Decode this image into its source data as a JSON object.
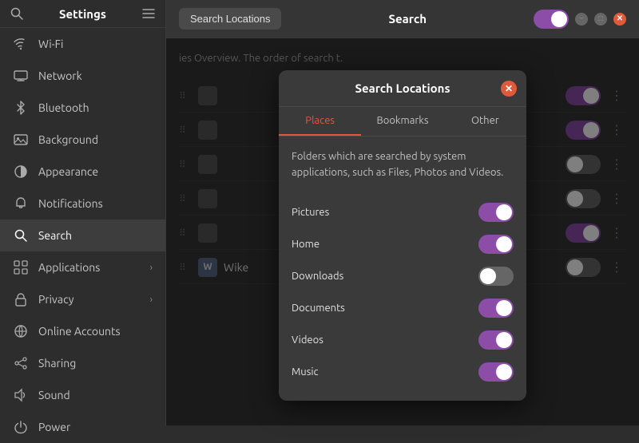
{
  "sidebar": {
    "title": "Settings",
    "items": [
      {
        "id": "wifi",
        "label": "Wi-Fi",
        "icon": "wifi"
      },
      {
        "id": "network",
        "label": "Network",
        "icon": "network"
      },
      {
        "id": "bluetooth",
        "label": "Bluetooth",
        "icon": "bluetooth"
      },
      {
        "id": "background",
        "label": "Background",
        "icon": "background"
      },
      {
        "id": "appearance",
        "label": "Appearance",
        "icon": "appearance"
      },
      {
        "id": "notifications",
        "label": "Notifications",
        "icon": "notifications"
      },
      {
        "id": "search",
        "label": "Search",
        "icon": "search",
        "active": true
      },
      {
        "id": "applications",
        "label": "Applications",
        "icon": "apps",
        "hasArrow": true
      },
      {
        "id": "privacy",
        "label": "Privacy",
        "icon": "privacy",
        "hasArrow": true
      },
      {
        "id": "online-accounts",
        "label": "Online Accounts",
        "icon": "online"
      },
      {
        "id": "sharing",
        "label": "Sharing",
        "icon": "sharing"
      },
      {
        "id": "sound",
        "label": "Sound",
        "icon": "sound"
      },
      {
        "id": "power",
        "label": "Power",
        "icon": "power"
      }
    ]
  },
  "header": {
    "search_locations_btn": "Search Locations",
    "title": "Search",
    "toggle_on": true
  },
  "main": {
    "description": "ies Overview. The order of search t.",
    "rows": [
      {
        "name": "Wike",
        "icon": "W",
        "toggleOn": false
      }
    ]
  },
  "modal": {
    "title": "Search Locations",
    "tabs": [
      "Places",
      "Bookmarks",
      "Other"
    ],
    "active_tab": "Places",
    "description": "Folders which are searched by system applications, such as Files, Photos and Videos.",
    "locations": [
      {
        "name": "Pictures",
        "on": true
      },
      {
        "name": "Home",
        "on": true
      },
      {
        "name": "Downloads",
        "on": false
      },
      {
        "name": "Documents",
        "on": true
      },
      {
        "name": "Videos",
        "on": true
      },
      {
        "name": "Music",
        "on": true
      }
    ]
  },
  "window": {
    "minimize": "−",
    "maximize": "□",
    "close": "✕"
  }
}
